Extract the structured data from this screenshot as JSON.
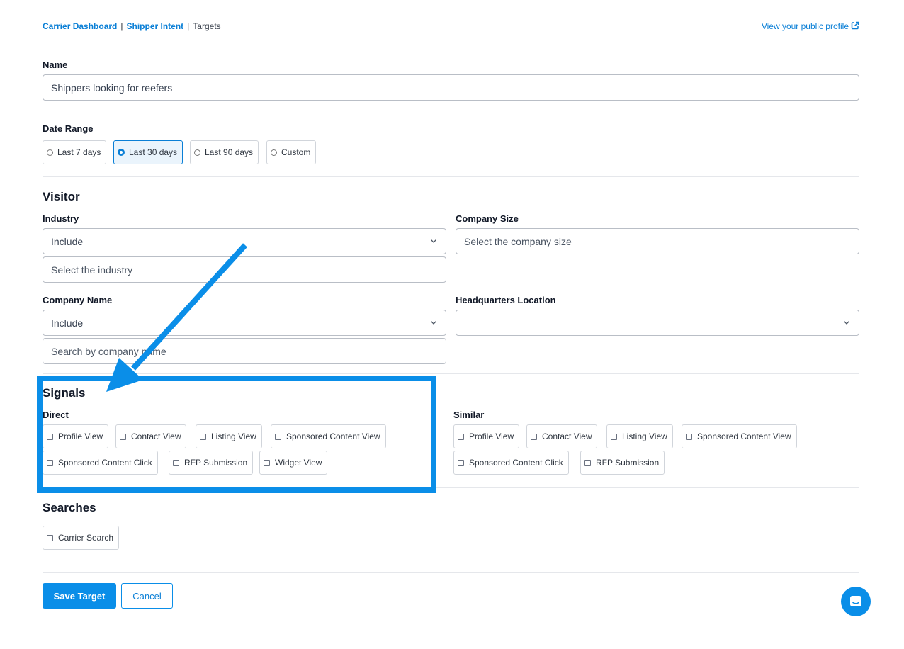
{
  "breadcrumb": {
    "items": [
      "Carrier Dashboard",
      "Shipper Intent",
      "Targets"
    ],
    "separator": "|"
  },
  "public_profile_link": "View your public profile",
  "name": {
    "label": "Name",
    "value": "Shippers looking for reefers"
  },
  "date_range": {
    "label": "Date Range",
    "options": [
      "Last 7 days",
      "Last 30 days",
      "Last 90 days",
      "Custom"
    ],
    "selected": "Last 30 days"
  },
  "visitor": {
    "heading": "Visitor",
    "industry": {
      "label": "Industry",
      "mode": "Include",
      "placeholder": "Select the industry"
    },
    "company_size": {
      "label": "Company Size",
      "placeholder": "Select the company size"
    },
    "company_name": {
      "label": "Company Name",
      "mode": "Include",
      "placeholder": "Search by company name"
    },
    "hq_location": {
      "label": "Headquarters Location",
      "value": ""
    }
  },
  "signals": {
    "heading": "Signals",
    "direct": {
      "label": "Direct",
      "options": [
        "Profile View",
        "Contact View",
        "Listing View",
        "Sponsored Content View",
        "Sponsored Content Click",
        "RFP Submission",
        "Widget View"
      ]
    },
    "similar": {
      "label": "Similar",
      "options": [
        "Profile View",
        "Contact View",
        "Listing View",
        "Sponsored Content View",
        "Sponsored Content Click",
        "RFP Submission"
      ]
    }
  },
  "searches": {
    "heading": "Searches",
    "options": [
      "Carrier Search"
    ]
  },
  "actions": {
    "save": "Save Target",
    "cancel": "Cancel"
  },
  "icons": {
    "external_link": "external-link-icon",
    "chevron": "chevron-down-icon",
    "chat": "chat-icon"
  },
  "colors": {
    "accent": "#0a8ee8",
    "link": "#0a7fd6",
    "annotation": "#0a8ee8"
  }
}
